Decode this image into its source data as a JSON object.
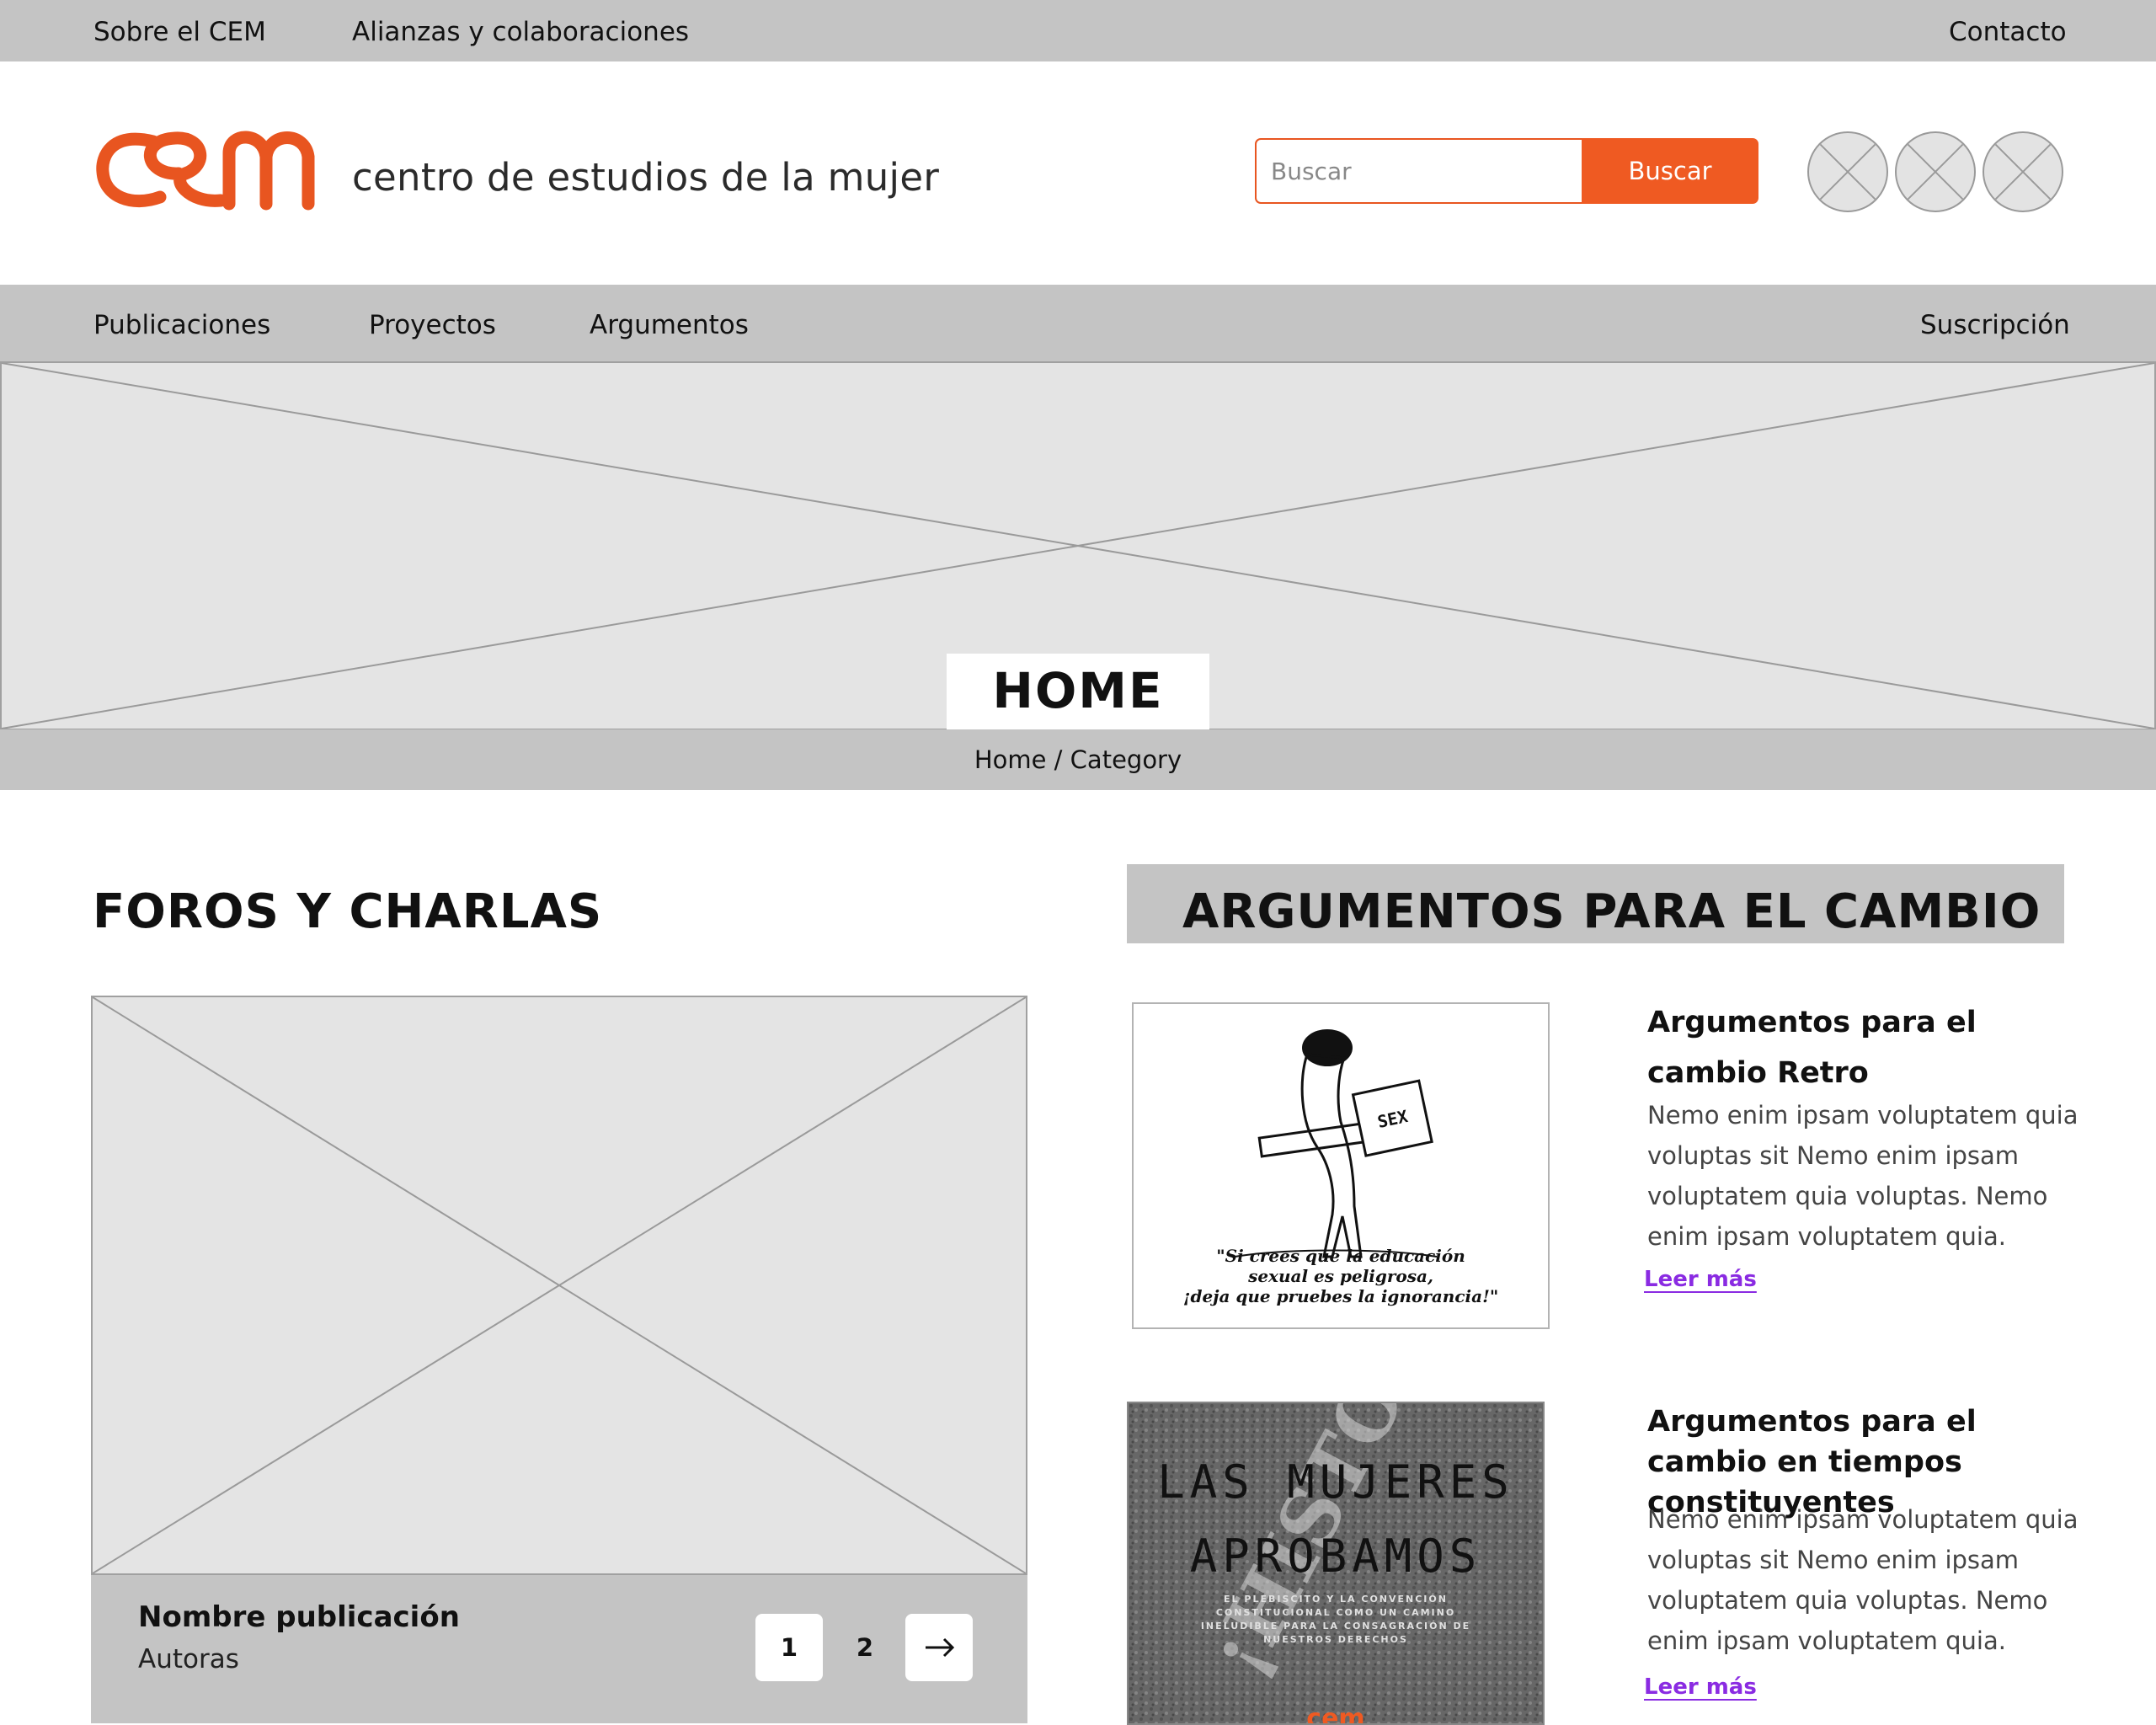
{
  "colors": {
    "accent": "#ef5a22",
    "nav_bg": "#c4c4c4",
    "placeholder_bg": "#e4e4e4",
    "link": "#8a2be2"
  },
  "topbar": {
    "items": [
      "Sobre el CEM",
      "Alianzas y colaboraciones"
    ],
    "contact": "Contacto"
  },
  "header": {
    "logo_icon": "cem-logo-icon",
    "tagline": "centro de estudios de la mujer",
    "search": {
      "placeholder": "Buscar",
      "button": "Buscar"
    },
    "social_icons": [
      "social-placeholder-icon",
      "social-placeholder-icon",
      "social-placeholder-icon"
    ]
  },
  "mainnav": {
    "items": [
      "Publicaciones",
      "Proyectos",
      "Argumentos"
    ],
    "right": "Suscripción"
  },
  "hero": {
    "title": "HOME",
    "breadcrumb": "Home / Category"
  },
  "left_section": {
    "title": "FOROS Y CHARLAS",
    "card": {
      "name": "Nombre publicación",
      "authors": "Autoras"
    },
    "pagination": {
      "pages": [
        "1",
        "2"
      ],
      "next_icon": "arrow-right-icon"
    }
  },
  "right_section": {
    "title": "ARGUMENTOS PARA EL CAMBIO",
    "articles": [
      {
        "title": "Argumentos para el cambio Retro",
        "text": "Nemo enim ipsam voluptatem quia voluptas sit Nemo enim ipsam voluptatem quia voluptas. Nemo enim ipsam voluptatem quia.",
        "link": "Leer más",
        "image_caption": [
          "\"Si crees que la educación",
          "sexual es peligrosa,",
          "¡deja que pruebes la ignorancia!\""
        ],
        "image_book_label": "SEX"
      },
      {
        "title": "Argumentos para el cambio en tiempos constituyentes",
        "text": "Nemo enim ipsam voluptatem quia voluptas sit Nemo enim ipsam voluptatem quia voluptas. Nemo enim ipsam voluptatem quia.",
        "link": "Leer más",
        "image_lines": [
          "LAS MUJERES",
          "APROBAMOS"
        ],
        "image_sub": [
          "EL PLEBISCITO Y LA CONVENCIÓN",
          "CONSTITUCIONAL COMO UN CAMINO",
          "INELUDIBLE PARA LA CONSAGRACIÓN DE",
          "NUESTROS DERECHOS"
        ],
        "image_side": "¡HISTÓRICAS!",
        "image_logo": "cem"
      }
    ]
  }
}
